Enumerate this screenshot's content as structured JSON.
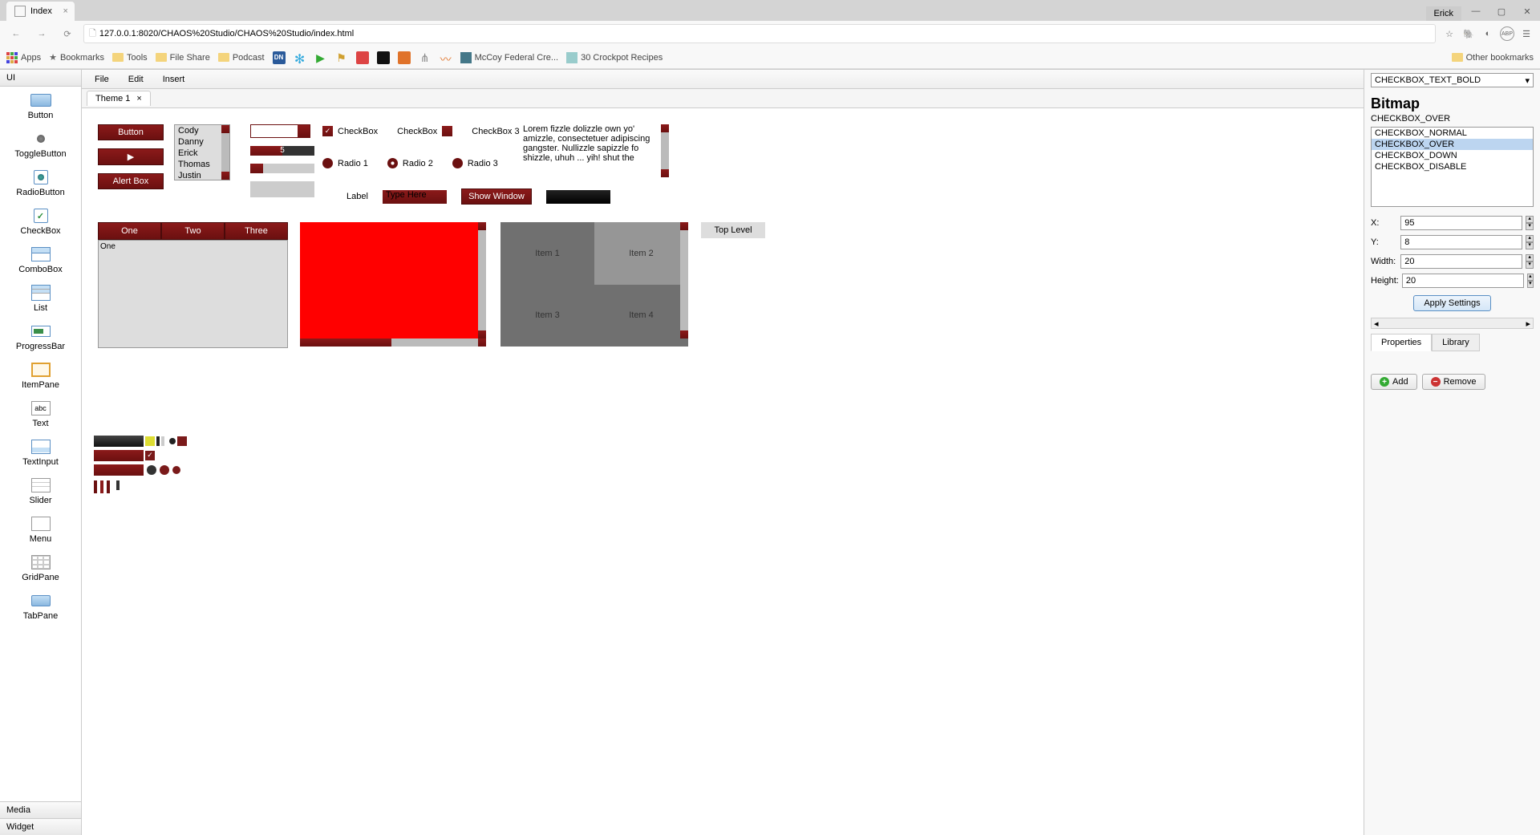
{
  "browser": {
    "tab_title": "Index",
    "user": "Erick",
    "url": "127.0.0.1:8020/CHAOS%20Studio/CHAOS%20Studio/index.html",
    "bookmarks": [
      "Apps",
      "Bookmarks",
      "Tools",
      "File Share",
      "Podcast",
      "McCoy Federal Cre...",
      "30 Crockpot Recipes"
    ],
    "other_bookmarks": "Other bookmarks"
  },
  "left": {
    "header": "UI",
    "items": [
      "Button",
      "ToggleButton",
      "RadioButton",
      "CheckBox",
      "ComboBox",
      "List",
      "ProgressBar",
      "ItemPane",
      "Text",
      "TextInput",
      "Slider",
      "Menu",
      "GridPane",
      "TabPane"
    ],
    "footer1": "Media",
    "footer2": "Widget"
  },
  "menu": [
    "File",
    "Edit",
    "Insert"
  ],
  "doc_tab": "Theme 1",
  "canvas": {
    "button": "Button",
    "alert_box": "Alert Box",
    "list": [
      "Cody",
      "Danny",
      "Erick",
      "Thomas",
      "Justin"
    ],
    "slider_value": "5",
    "cb1": "CheckBox",
    "cb2": "CheckBox",
    "cb3": "CheckBox 3",
    "radio1": "Radio 1",
    "radio2": "Radio 2",
    "radio3": "Radio 3",
    "label": "Label",
    "input_placeholder": "Type Here",
    "show_window": "Show Window",
    "lorem": "Lorem fizzle dolizzle own yo' amizzle, consectetuer adipiscing gangster. Nullizzle sapizzle fo shizzle, uhuh ... yih! shut the",
    "tabs": [
      "One",
      "Two",
      "Three"
    ],
    "tab_body": "One",
    "grid": [
      "Item 1",
      "Item 2",
      "Item 3",
      "Item 4"
    ],
    "top_level": "Top Level"
  },
  "right": {
    "combo_value": "CHECKBOX_TEXT_BOLD",
    "section_title": "Bitmap",
    "item_name": "CHECKBOX_OVER",
    "list": [
      "CHECKBOX_NORMAL",
      "CHECKBOX_OVER",
      "CHECKBOX_DOWN",
      "CHECKBOX_DISABLE"
    ],
    "fields": {
      "x_label": "X:",
      "x": "95",
      "y_label": "Y:",
      "y": "8",
      "w_label": "Width:",
      "w": "20",
      "h_label": "Height:",
      "h": "20"
    },
    "apply": "Apply Settings",
    "tabs": [
      "Properties",
      "Library"
    ],
    "add": "Add",
    "remove": "Remove"
  }
}
